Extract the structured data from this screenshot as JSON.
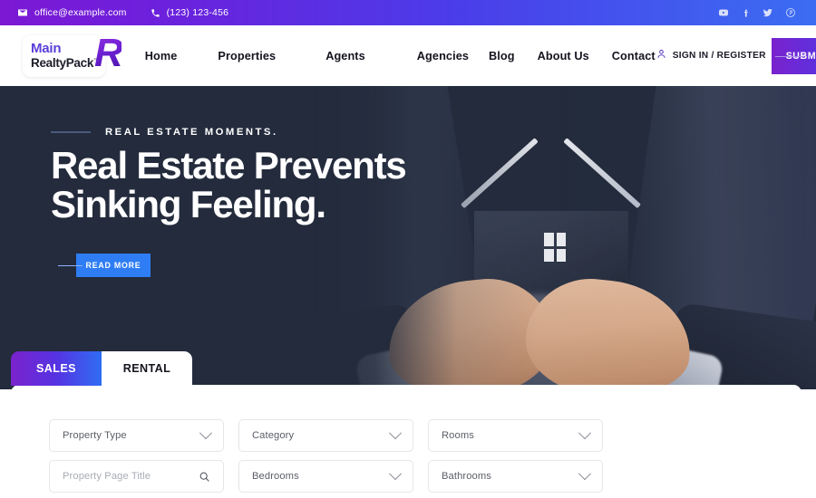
{
  "topbar": {
    "email": "office@example.com",
    "phone": "(123) 123-456",
    "email_icon": "envelope-icon",
    "phone_icon": "phone-icon",
    "social": [
      {
        "name": "youtube-icon",
        "label": "YouTube"
      },
      {
        "name": "facebook-icon",
        "label": "Facebook"
      },
      {
        "name": "twitter-icon",
        "label": "Twitter"
      },
      {
        "name": "pinterest-icon",
        "label": "Pinterest"
      }
    ],
    "gradient_from": "#7c18d4",
    "gradient_to": "#3b6df2"
  },
  "header": {
    "logo": {
      "line1": "Main",
      "line2": "RealtyPack",
      "mark": "R",
      "tm": "™"
    },
    "nav": [
      {
        "label": "Home"
      },
      {
        "label": "Properties"
      },
      {
        "label": "Agents"
      },
      {
        "label": "Agencies"
      },
      {
        "label": "Blog"
      },
      {
        "label": "About Us"
      },
      {
        "label": "Contact"
      }
    ],
    "signin_label": "SIGN IN / REGISTER",
    "signin_icon": "user-icon",
    "submit_label": "SUBMIT PROPERTY",
    "submit_gradient_from": "#7a22cd",
    "submit_gradient_to": "#3b70f0"
  },
  "hero": {
    "overline": "REAL ESTATE MOMENTS.",
    "title_line1": "Real Estate Prevents",
    "title_line2": "Sinking Feeling.",
    "cta_label": "READ MORE",
    "cta_color": "#2f7df4",
    "background_color": "#232b3c",
    "image_description": "businessman in dark suit holding glass house icon in cupped hands"
  },
  "search": {
    "tabs": [
      {
        "label": "SALES",
        "active": true
      },
      {
        "label": "RENTAL",
        "active": false
      }
    ],
    "row1": [
      {
        "label": "Property Type",
        "icon": "chevron-down-icon",
        "placeholder": false
      },
      {
        "label": "Category",
        "icon": "chevron-down-icon",
        "placeholder": false
      },
      {
        "label": "Rooms",
        "icon": "chevron-down-icon",
        "placeholder": false
      }
    ],
    "row2": [
      {
        "label": "Property Page Title",
        "icon": "search-icon",
        "placeholder": true
      },
      {
        "label": "Bedrooms",
        "icon": "chevron-down-icon",
        "placeholder": false
      },
      {
        "label": "Bathrooms",
        "icon": "chevron-down-icon",
        "placeholder": false
      }
    ]
  }
}
